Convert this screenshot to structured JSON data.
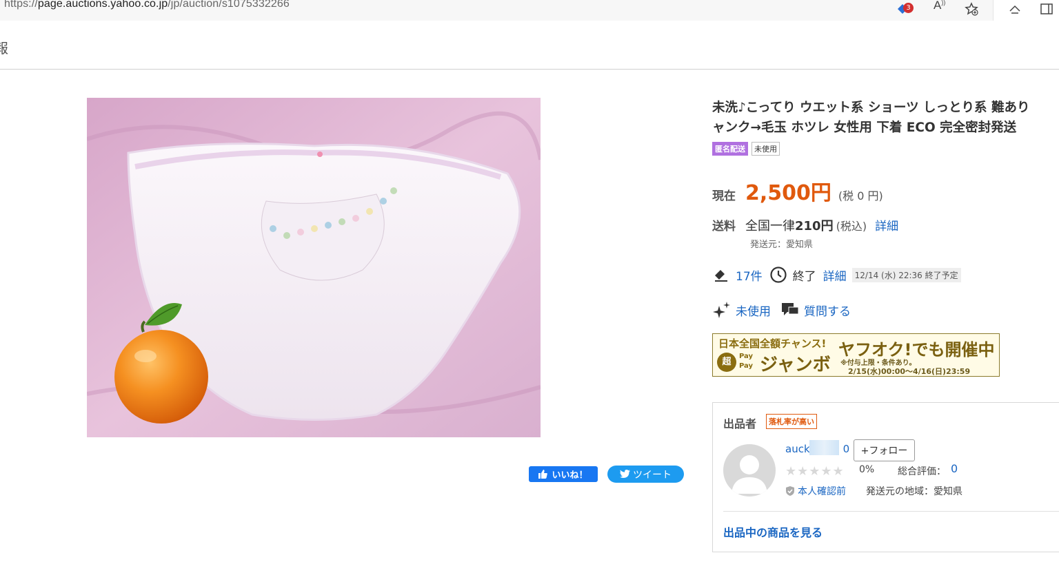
{
  "browser": {
    "url_prefix": "https://",
    "url_host": "page.auctions.yahoo.co.jp",
    "url_path": "/jp/auction/s1075332266",
    "badge_count": "3",
    "read_aloud": "A"
  },
  "site": {
    "strip_text": "報"
  },
  "listing": {
    "title_line1": "未洗♪こってり ウエット系 ショーツ しっとり系 難あり",
    "title_line2": "ャンク→毛玉 ホツレ 女性用 下着 ECO 完全密封発送",
    "badge_anonymous": "匿名配送",
    "badge_condition": "未使用",
    "price_label": "現在",
    "price_value": "2,500円",
    "price_tax": "(税 0 円)",
    "shipping_label": "送料",
    "shipping_prefix": "全国一律",
    "shipping_amount": "210円",
    "shipping_tax": "(税込)",
    "shipping_detail": "詳細",
    "shipping_origin": "発送元：愛知県",
    "bids": "17件",
    "end_status": "終了",
    "end_detail": "詳細",
    "end_time": "12/14 (水) 22:36 終了予定",
    "condition": "未使用",
    "ask_question": "質問する"
  },
  "banner": {
    "left_title": "日本全国全額チャンス!",
    "right_title": "ヤフオク!でも開催中",
    "circle": "超",
    "pay_line1": "Pay",
    "pay_line2": "Pay",
    "jumbo": "ジャンボ",
    "note1": "※付与上限・条件あり。",
    "note2": "2/15(水)00:00〜4/16(日)23:59"
  },
  "share": {
    "like": "いいね！",
    "tweet": "ツイート"
  },
  "seller": {
    "label": "出品者",
    "tag": "落札率が高い",
    "name_start": "auck",
    "name_end": "0",
    "follow": "+フォロー",
    "stars": "★★★★★",
    "success_rate": "0%",
    "rating_label": "総合評価：",
    "rating_value": "0",
    "verification": "本人確認前",
    "origin": "発送元の地域：愛知県",
    "more_items": "出品中の商品を見る"
  },
  "colors": {
    "price": "#e0590d",
    "link": "#1a66c2",
    "anon_badge": "#b070e0",
    "like": "#1877f2",
    "tweet": "#1d9bf0"
  },
  "icons": [
    "notification-icon",
    "read-aloud-icon",
    "favorites-icon",
    "collections-icon",
    "gavel-icon",
    "clock-icon",
    "sparkle-icon",
    "chat-icon",
    "thumbs-up-icon",
    "twitter-icon",
    "shield-check-icon",
    "avatar-icon",
    "orange-icon"
  ]
}
